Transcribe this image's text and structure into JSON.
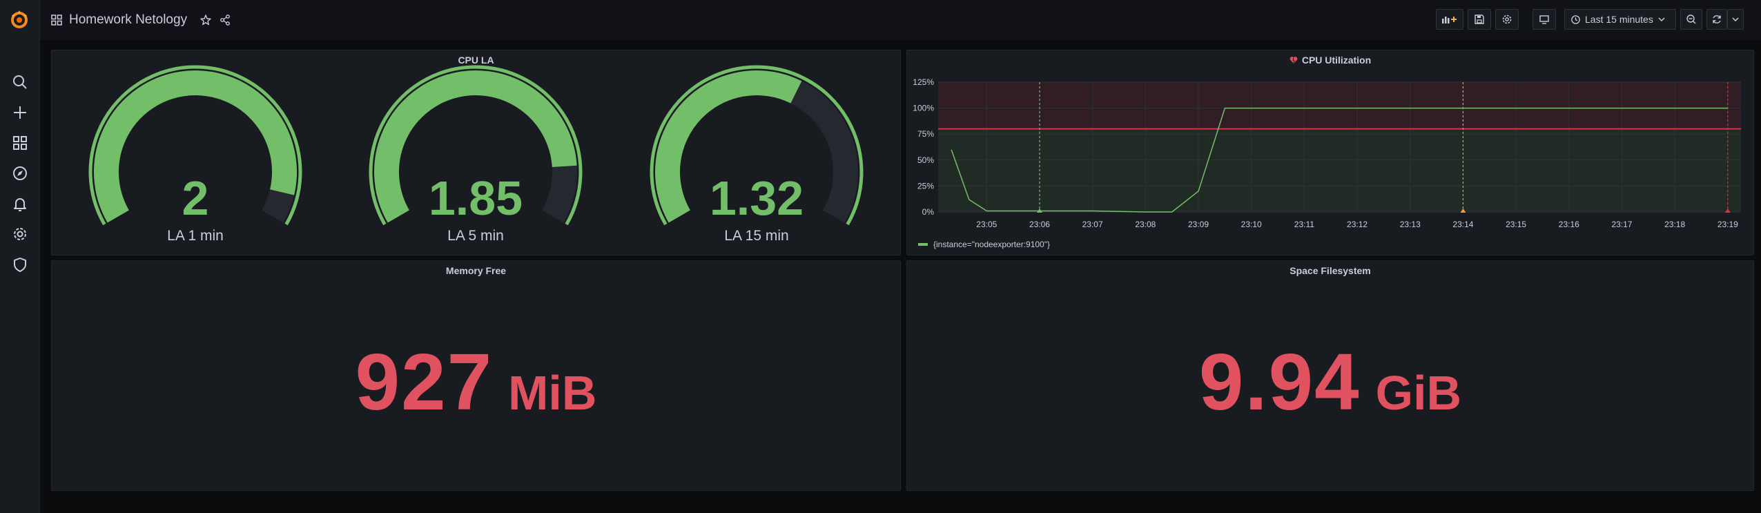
{
  "dashboard": {
    "title": "Homework Netology"
  },
  "toolbar": {
    "time_range": "Last 15 minutes"
  },
  "sidebar": {
    "items": [
      {
        "name": "search-icon"
      },
      {
        "name": "plus-icon"
      },
      {
        "name": "dashboards-icon"
      },
      {
        "name": "explore-compass-icon"
      },
      {
        "name": "alerting-bell-icon"
      },
      {
        "name": "configuration-gear-icon"
      },
      {
        "name": "server-admin-shield-icon"
      }
    ]
  },
  "colors": {
    "green": "#73bf69",
    "red": "#e0525f",
    "track": "#262830"
  },
  "panels": {
    "cpu_la": {
      "title": "CPU LA",
      "gauges": [
        {
          "value": "2",
          "label": "LA 1 min",
          "fraction": 0.93,
          "min": 0,
          "max": 2.15
        },
        {
          "value": "1.85",
          "label": "LA 5 min",
          "fraction": 0.86,
          "min": 0,
          "max": 2.15
        },
        {
          "value": "1.32",
          "label": "LA 15 min",
          "fraction": 0.61,
          "min": 0,
          "max": 2.15
        }
      ]
    },
    "cpu_util": {
      "title": "CPU Utilization",
      "legend": "{instance=\"nodeexporter:9100\"}"
    },
    "memory": {
      "title": "Memory Free",
      "value": "927",
      "unit": "MiB"
    },
    "space": {
      "title": "Space Filesystem",
      "value": "9.94",
      "unit": "GiB"
    }
  },
  "chart_data": {
    "type": "line",
    "title": "CPU Utilization",
    "x": [
      "23:04:20",
      "23:04:40",
      "23:05:00",
      "23:06:00",
      "23:07:00",
      "23:08:00",
      "23:08:30",
      "23:09:00",
      "23:09:30",
      "23:10:00",
      "23:11:00",
      "23:12:00",
      "23:13:00",
      "23:14:00",
      "23:15:00",
      "23:16:00",
      "23:17:00",
      "23:18:00",
      "23:19:00"
    ],
    "series": [
      {
        "name": "{instance=\"nodeexporter:9100\"}",
        "values": [
          60,
          12,
          1,
          1,
          1,
          0,
          0,
          20,
          100,
          100,
          100,
          100,
          100,
          100,
          100,
          100,
          100,
          100,
          100
        ]
      }
    ],
    "x_ticks": [
      "23:05",
      "23:06",
      "23:07",
      "23:08",
      "23:09",
      "23:10",
      "23:11",
      "23:12",
      "23:13",
      "23:14",
      "23:15",
      "23:16",
      "23:17",
      "23:18",
      "23:19"
    ],
    "y_ticks": [
      "0%",
      "25%",
      "50%",
      "75%",
      "100%",
      "125%"
    ],
    "ylim": [
      0,
      125
    ],
    "thresholds": [
      {
        "value": 80,
        "color": "#e02f44"
      }
    ],
    "legend": "bottom-left",
    "grid": true
  }
}
